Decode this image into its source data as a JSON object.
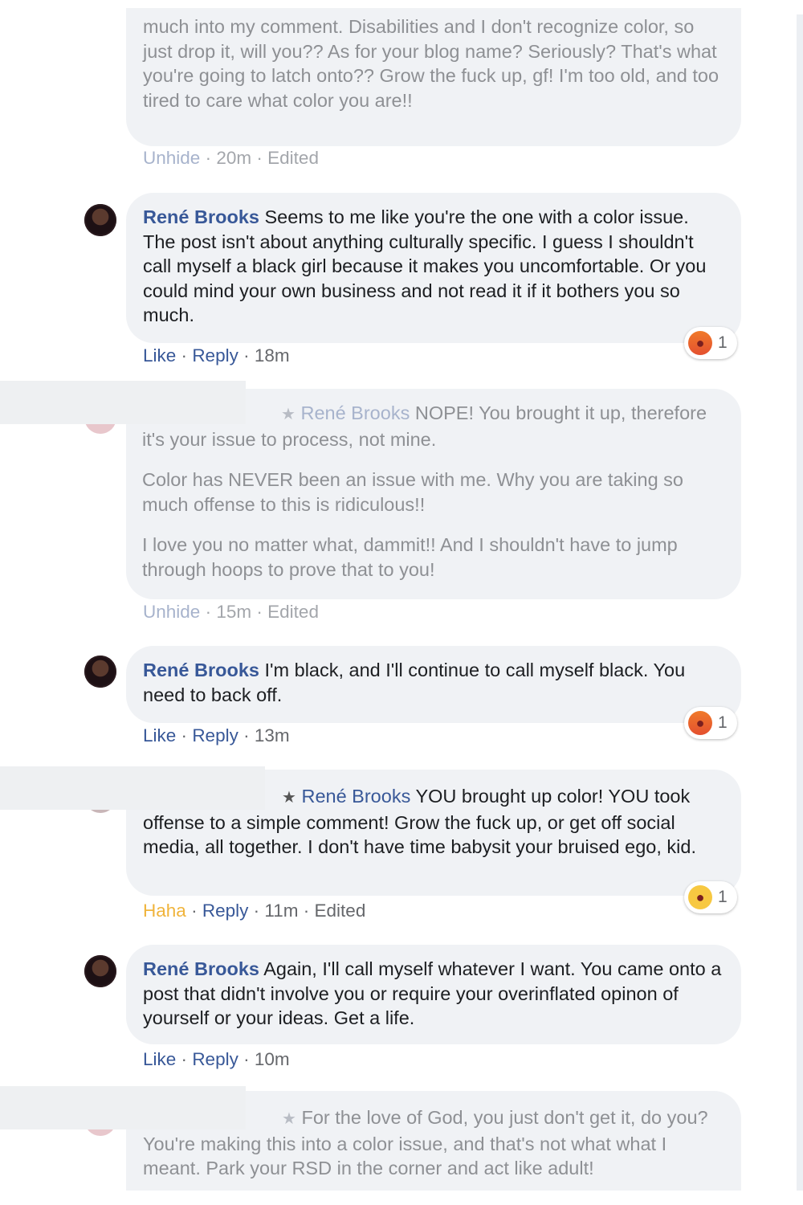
{
  "comments": [
    {
      "text_lines": "much into my comment. Disabilities and I don't recognize color, so just drop it, will you?? As for your blog name? Seriously? That's what you're going to latch onto?? Grow the fuck up, gf! I'm too old, and too tired to care what color you are!!",
      "action": "Unhide",
      "time": "20m",
      "edited": "Edited"
    },
    {
      "author": "René Brooks",
      "text": "Seems to me like you're the one with a color issue. The post isn't about anything culturally specific. I guess I shouldn't call myself a black girl because it makes you uncomfortable. Or you could mind your own business and not read it if it bothers you so much.",
      "action": "Like",
      "reply": "Reply",
      "time": "18m",
      "reaction": {
        "icon": "angry-emoji-icon",
        "count": "1"
      }
    },
    {
      "mention": "René Brooks",
      "text_first": "NOPE! You brought it up, therefore it's your issue to process, not mine.",
      "text_second": "Color has NEVER been an issue with me. Why you are taking so much offense to this is ridiculous!!",
      "text_third": "I love you no matter what, dammit!! And I shouldn't have to jump through hoops to prove that to you!",
      "action": "Unhide",
      "time": "15m",
      "edited": "Edited"
    },
    {
      "author": "René Brooks",
      "text": "I'm black, and I'll continue to call myself black. You need to back off.",
      "action": "Like",
      "reply": "Reply",
      "time": "13m",
      "reaction": {
        "icon": "angry-emoji-icon",
        "count": "1"
      }
    },
    {
      "mention": "René Brooks",
      "text": "YOU brought up color! YOU took offense to a simple comment! Grow the fuck up, or get off social media, all together. I don't have time babysit your bruised ego, kid.",
      "action": "Haha",
      "reply": "Reply",
      "time": "11m",
      "edited": "Edited",
      "reaction": {
        "icon": "haha-emoji-icon",
        "count": "1"
      }
    },
    {
      "author": "René Brooks",
      "text": "Again, I'll call myself whatever I want. You came onto a post that didn't involve you or require your overinflated opinon of yourself or your ideas. Get a life.",
      "action": "Like",
      "reply": "Reply",
      "time": "10m"
    },
    {
      "text": "For the love of God, you just don't get it, do you? You're making this into a color issue, and that's not what what I meant. Park your RSD in the corner and act like adult!"
    }
  ],
  "separator": "·",
  "colors": {
    "link": "#385898",
    "bubble": "#f0f2f5",
    "haha": "#f0b43c",
    "angry": "#e4502f"
  }
}
